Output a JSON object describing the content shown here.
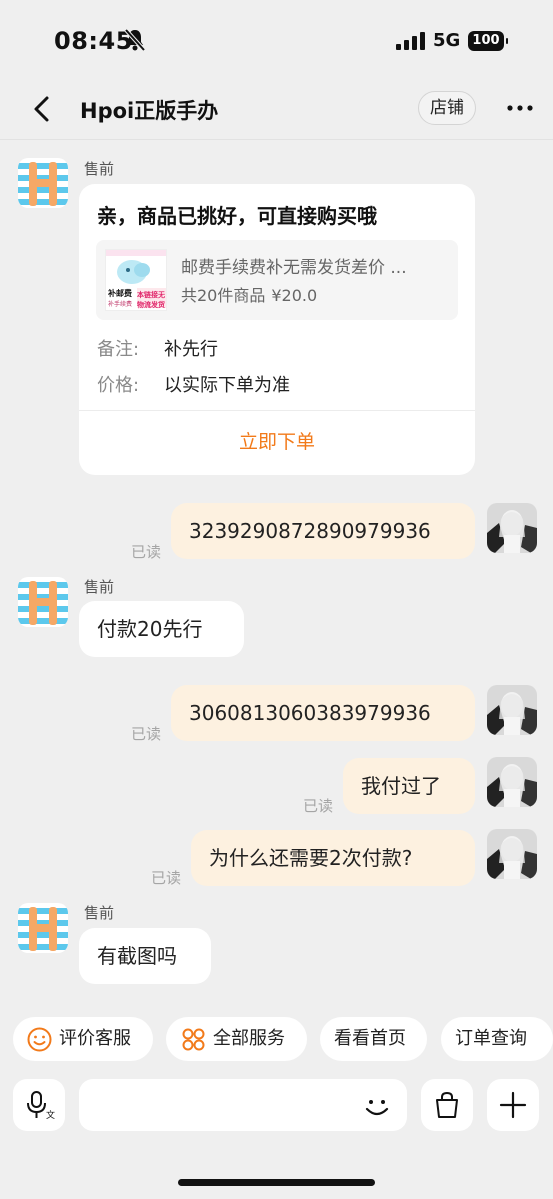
{
  "status_bar": {
    "time": "08:45",
    "network": "5G",
    "battery": "100"
  },
  "nav": {
    "title": "Hpoi正版手办",
    "store_label": "店铺"
  },
  "messages": {
    "m1_sender": "售前",
    "card": {
      "title": "亲，商品已挑好，可直接购买哦",
      "product_name": "邮费手续费补无需发货差价 ...",
      "product_count": "共20件商品",
      "product_price": "¥20.0",
      "thumb_title": "补邮费",
      "thumb_sub": "补手续费",
      "thumb_badge1": "本链接无",
      "thumb_badge2": "物流发货",
      "remark_key": "备注:",
      "remark_val": "补先行",
      "price_key": "价格:",
      "price_val": "以实际下单为准",
      "action": "立即下单"
    },
    "m2_text": "3239290872890979936",
    "m2_read": "已读",
    "m3_sender": "售前",
    "m3_text": "付款20先行",
    "m4_text": "3060813060383979936",
    "m4_read": "已读",
    "m5_text": "我付过了",
    "m5_read": "已读",
    "m6_text": "为什么还需要2次付款?",
    "m6_read": "已读",
    "m7_sender": "售前",
    "m7_text": "有截图吗"
  },
  "quick_actions": {
    "rate_service": "评价客服",
    "all_services": "全部服务",
    "view_home": "看看首页",
    "order_query": "订单查询"
  },
  "input": {
    "value": "",
    "placeholder": ""
  },
  "colors": {
    "accent": "#f27a1a",
    "bubble_self": "#fdf1e0",
    "background": "#efefef"
  }
}
